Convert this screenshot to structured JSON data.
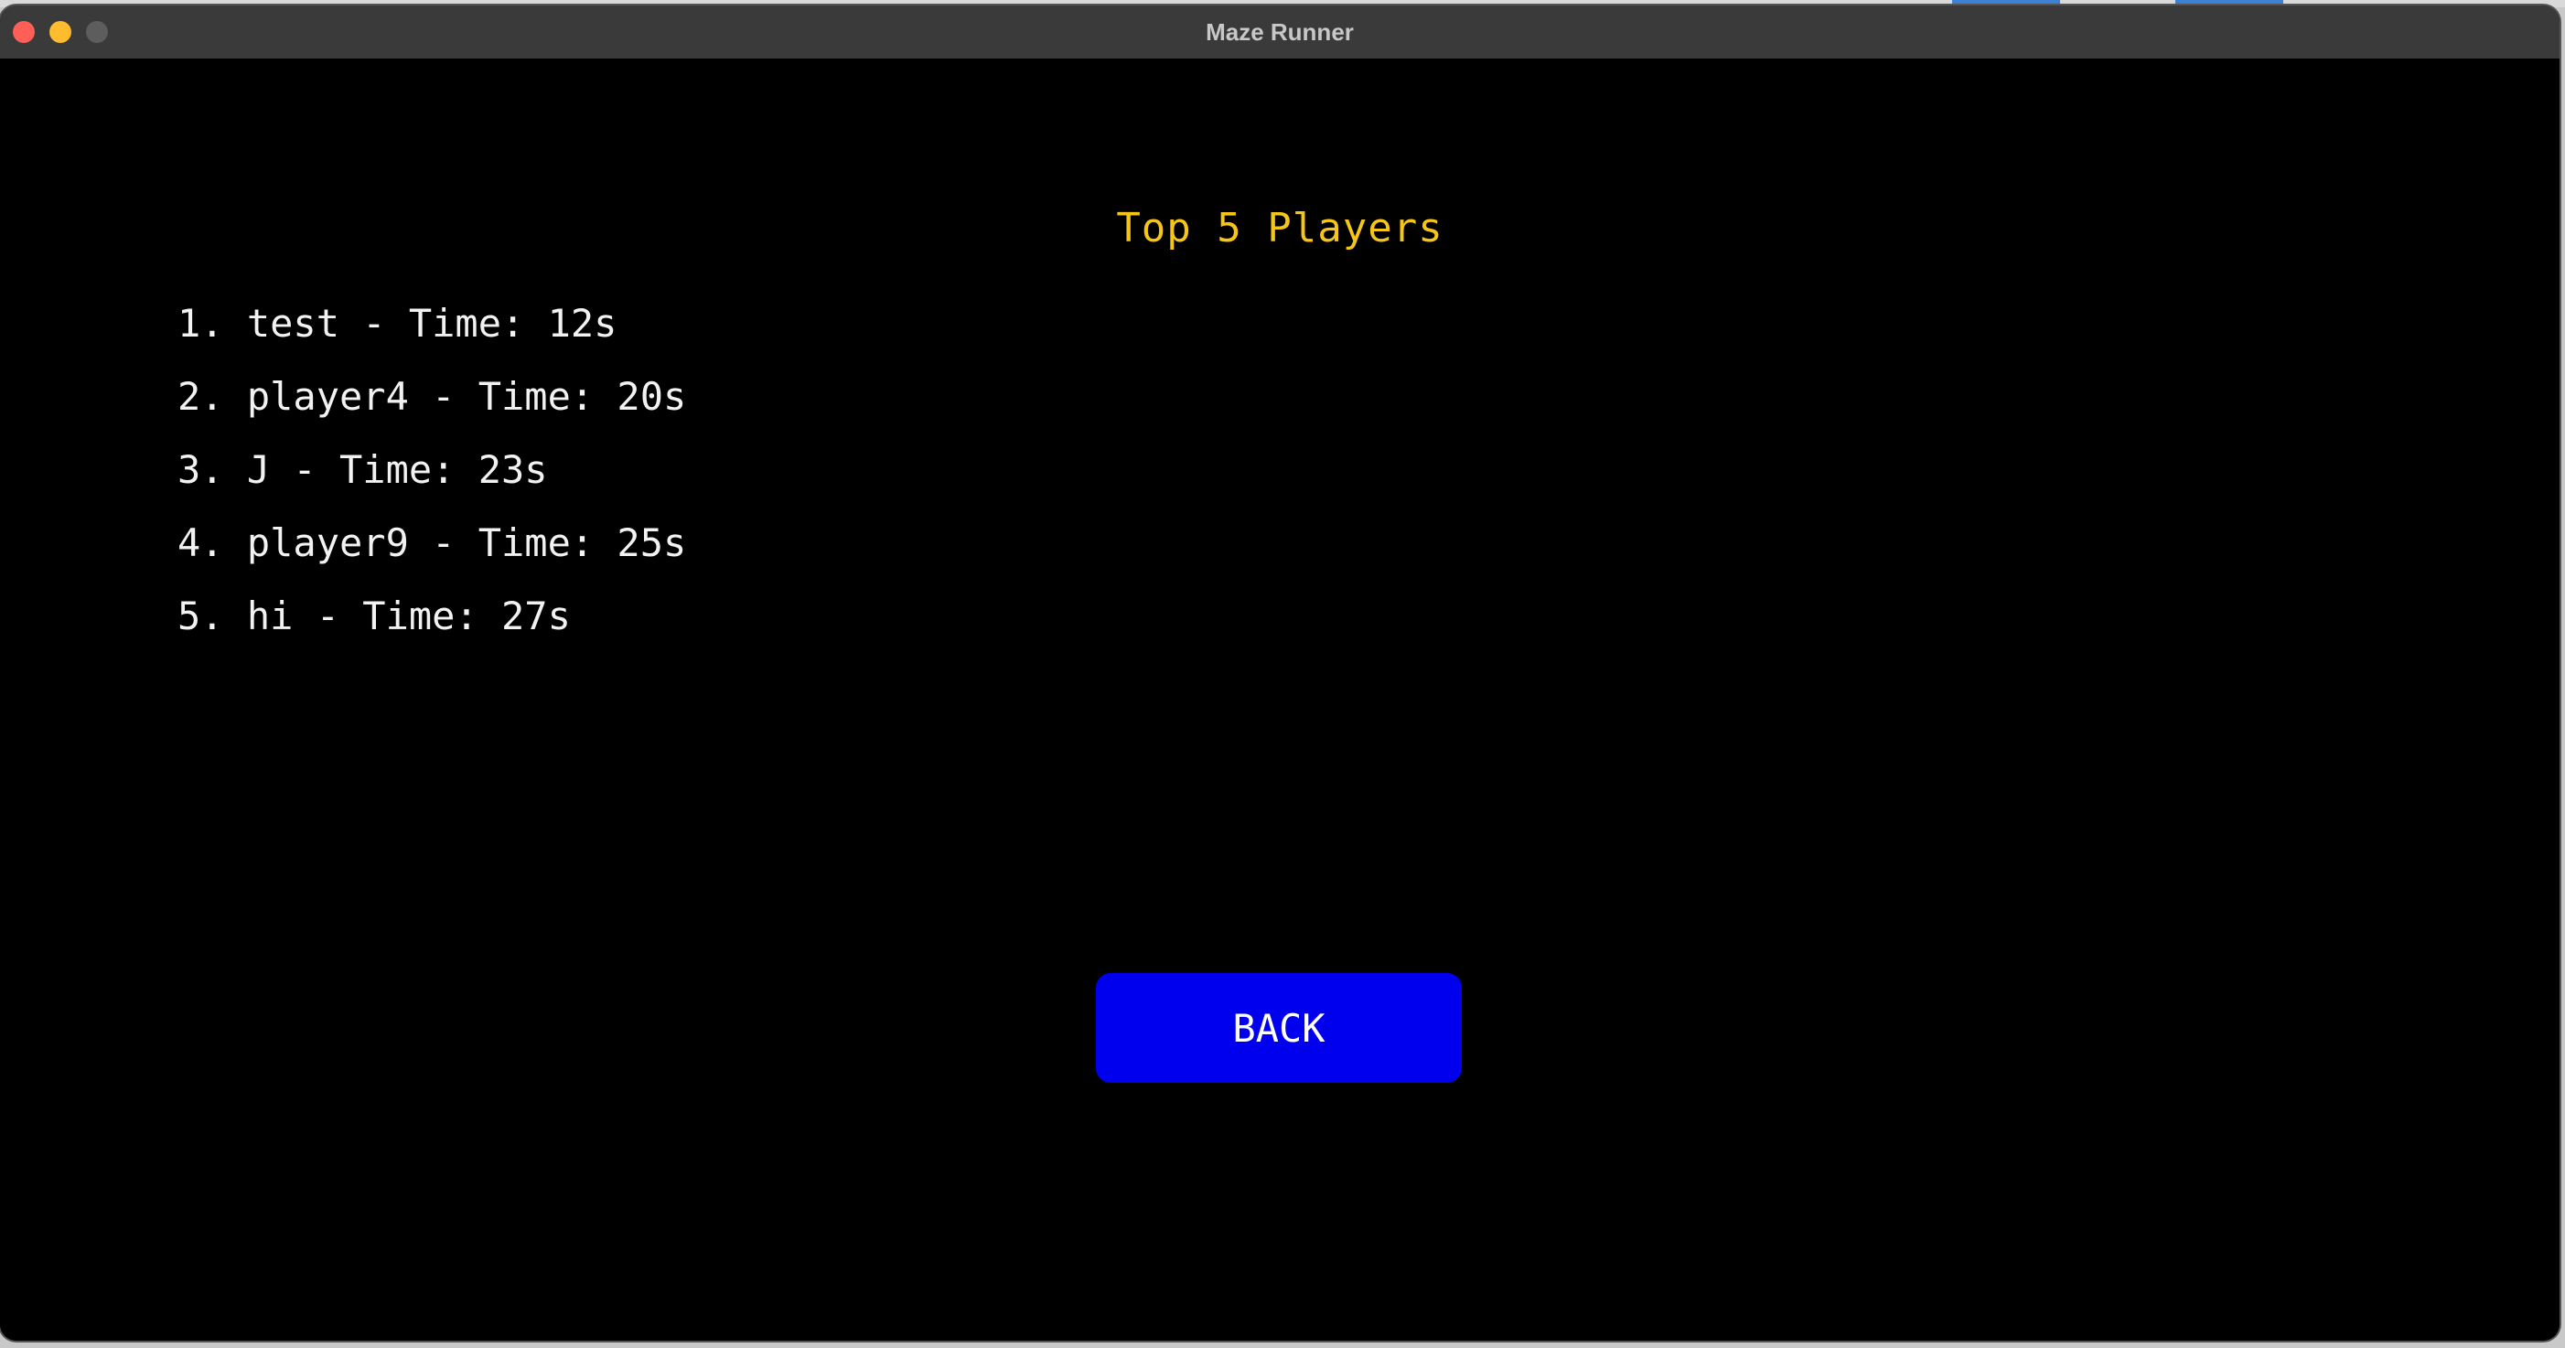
{
  "window": {
    "title": "Maze Runner"
  },
  "leaderboard": {
    "title": "Top 5 Players",
    "entries": [
      "1. test - Time: 12s",
      "2. player4 - Time: 20s",
      "3. J - Time: 23s",
      "4. player9 - Time: 25s",
      "5. hi - Time: 27s"
    ]
  },
  "actions": {
    "back_label": "BACK"
  },
  "colors": {
    "background": "#000000",
    "title": "#f5c518",
    "text": "#f2f2f2",
    "button": "#0000ee"
  },
  "icons": {
    "close": "close-icon",
    "minimize": "minimize-icon",
    "zoom": "zoom-icon"
  }
}
